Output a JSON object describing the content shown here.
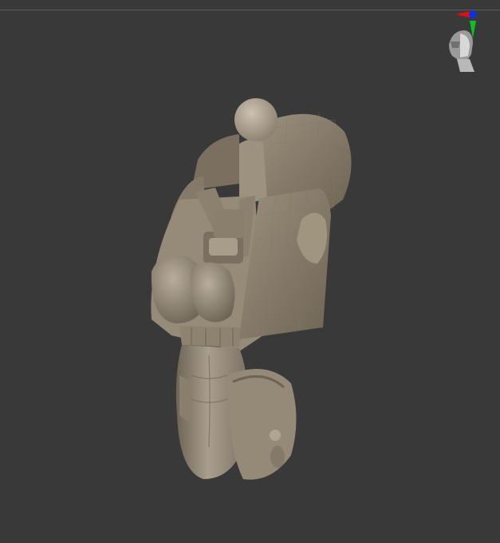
{
  "viewport": {
    "background_color": "#393939",
    "model_color": "#a59a8a"
  },
  "gizmo": {
    "icon": "head-orientation-icon",
    "x_color": "#e01010",
    "y_color": "#10c020",
    "z_color": "#1030e0"
  }
}
